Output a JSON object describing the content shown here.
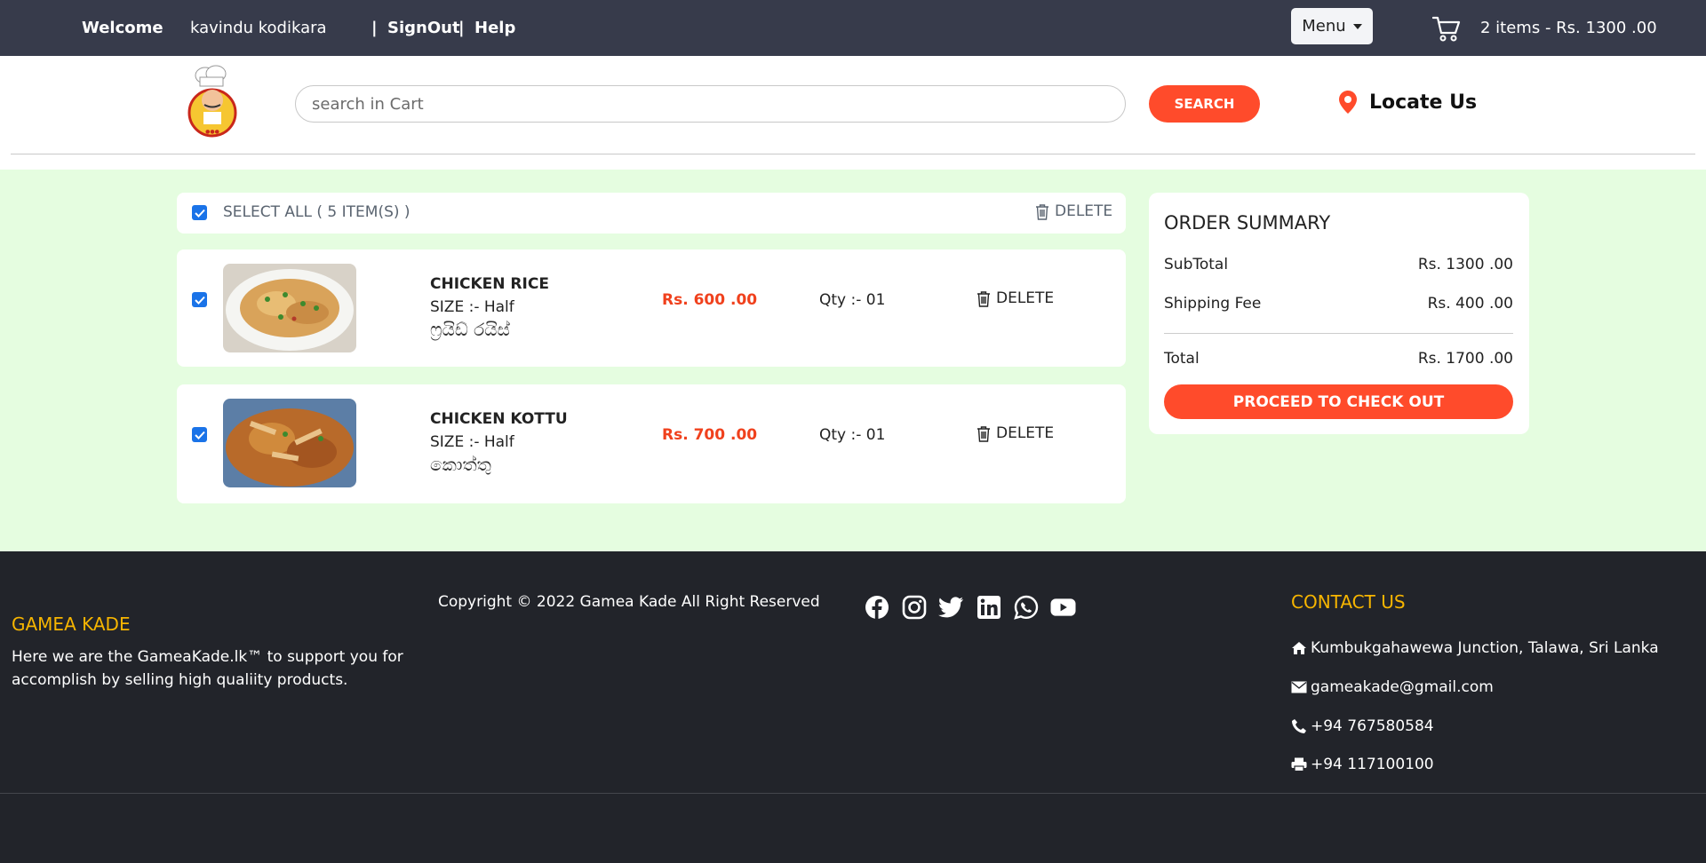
{
  "topbar": {
    "welcome": "Welcome",
    "user_name": "kavindu kodikara",
    "sep1": "|",
    "signout": "SignOut",
    "sep2": "|",
    "help": "Help",
    "menu_label": "Menu",
    "cart_summary": "2 items - Rs. 1300 .00"
  },
  "header": {
    "search_placeholder": "search in Cart",
    "search_button": "SEARCH",
    "locate_label": "Locate Us"
  },
  "cart": {
    "select_all_label": "SELECT ALL ( 5 ITEM(S) )",
    "delete_all_label": "DELETE",
    "items": [
      {
        "name": "CHICKEN RICE",
        "size": "SIZE :- Half",
        "native_name": "ෆ්‍රයිඩ් රයිස්",
        "price": "Rs. 600 .00",
        "qty": "Qty :- 01",
        "delete": "DELETE",
        "checked": true
      },
      {
        "name": "CHICKEN KOTTU",
        "size": "SIZE :- Half",
        "native_name": "කොත්තු",
        "price": "Rs. 700 .00",
        "qty": "Qty :- 01",
        "delete": "DELETE",
        "checked": true
      }
    ]
  },
  "summary": {
    "title": "ORDER SUMMARY",
    "subtotal_label": "SubTotal",
    "subtotal_value": "Rs. 1300 .00",
    "shipping_label": "Shipping Fee",
    "shipping_value": "Rs. 400 .00",
    "total_label": "Total",
    "total_value": "Rs. 1700 .00",
    "checkout_button": "PROCEED TO CHECK OUT"
  },
  "footer": {
    "brand": "GAMEA KADE",
    "description": "Here we are the GameaKade.lk™ to support you for accomplish by selling high qualiity products.",
    "copyright": "Copyright © 2022 Gamea Kade All Right Reserved",
    "socials": [
      "facebook-icon",
      "instagram-icon",
      "twitter-icon",
      "linkedin-icon",
      "whatsapp-icon",
      "youtube-icon"
    ],
    "contact_title": "CONTACT US",
    "address": "Kumbukgahawewa Junction, Talawa, Sri Lanka",
    "email": "gameakade@gmail.com",
    "phone": "+94 767580584",
    "fax": "+94 117100100"
  },
  "colors": {
    "topbar_bg": "#373b4b",
    "accent": "#ff4b2b",
    "main_bg": "#e5fde0",
    "footer_bg": "#22242a",
    "footer_heading": "#f7b500",
    "checkbox": "#1a73e8"
  }
}
